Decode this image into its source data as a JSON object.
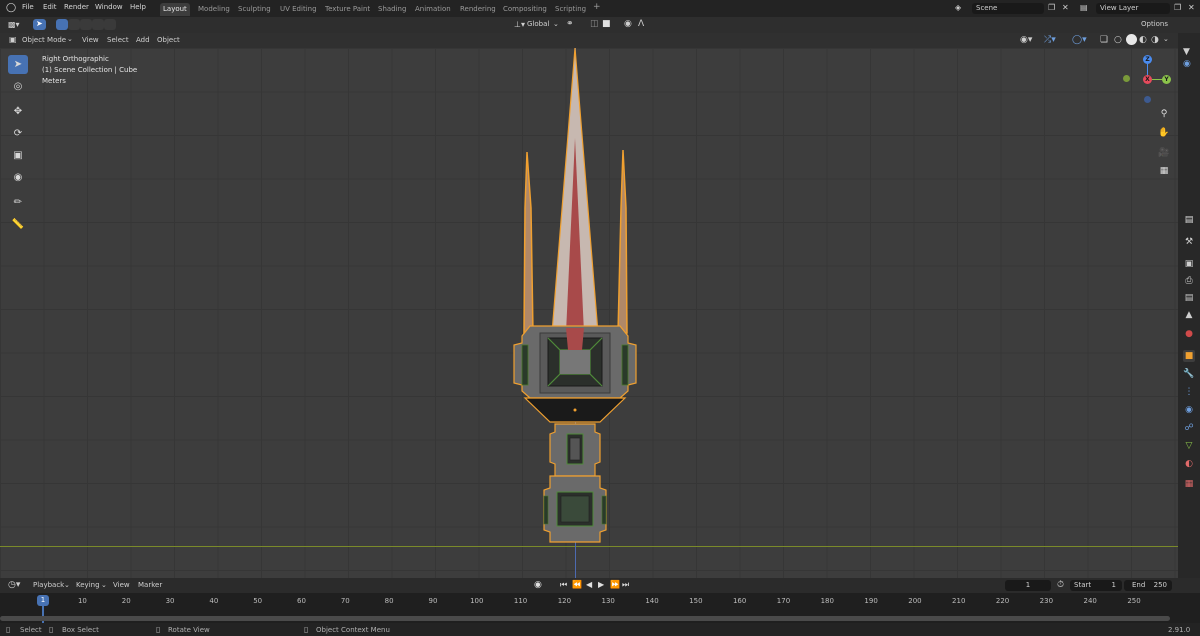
{
  "menu": {
    "file": "File",
    "edit": "Edit",
    "render": "Render",
    "window": "Window",
    "help": "Help"
  },
  "workspaces": [
    "Layout",
    "Modeling",
    "Sculpting",
    "UV Editing",
    "Texture Paint",
    "Shading",
    "Animation",
    "Rendering",
    "Compositing",
    "Scripting"
  ],
  "add_workspace": "+",
  "scene_field": "Scene",
  "view_layer_field": "View Layer",
  "header": {
    "transform_orientation": "Global",
    "options": "Options"
  },
  "view_header": {
    "mode": "Object Mode",
    "view": "View",
    "select": "Select",
    "add": "Add",
    "object": "Object"
  },
  "viewport_info": {
    "view_name": "Right Orthographic",
    "collection": "(1) Scene Collection | Cube",
    "units": "Meters"
  },
  "gizmo": {
    "z": "Z",
    "x": "X",
    "y": "Y"
  },
  "timeline": {
    "playback": "Playback",
    "keying": "Keying",
    "view": "View",
    "marker": "Marker",
    "current_frame": "1",
    "start_label": "Start",
    "start_value": "1",
    "end_label": "End",
    "end_value": "250",
    "ticks": [
      "1",
      "10",
      "20",
      "30",
      "40",
      "50",
      "60",
      "70",
      "80",
      "90",
      "100",
      "110",
      "120",
      "130",
      "140",
      "150",
      "160",
      "170",
      "180",
      "190",
      "200",
      "210",
      "220",
      "230",
      "240",
      "250"
    ]
  },
  "statusbar": {
    "select": "Select",
    "box_select": "Box Select",
    "rotate_view": "Rotate View",
    "context_menu": "Object Context Menu",
    "version": "2.91.0"
  },
  "colors": {
    "accent": "#4772b3",
    "selection_outline": "#f0a030",
    "axis_x": "#e64a5c",
    "axis_y": "#8bc34a",
    "axis_z": "#4a8cf0"
  }
}
